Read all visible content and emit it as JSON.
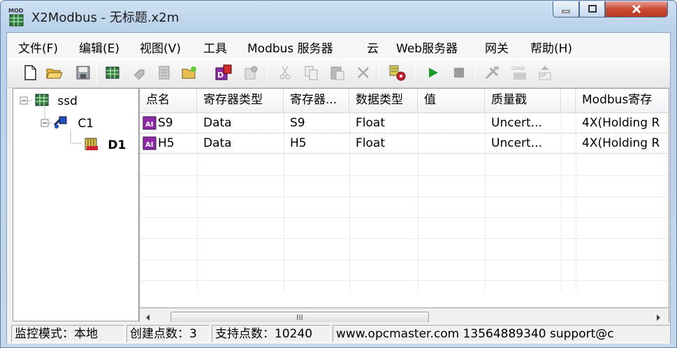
{
  "window": {
    "title": "X2Modbus - 无标题.x2m",
    "icon": "x2modbus-app-icon"
  },
  "menu": [
    "文件(F)",
    "编辑(E)",
    "视图(V)",
    "工具",
    "Modbus 服务器",
    "云",
    "Web服务器",
    "网关",
    "帮助(H)"
  ],
  "toolbar": [
    "new-file-icon",
    "open-folder-icon",
    "save-icon",
    "add-device-icon",
    "add-group-icon",
    "properties-icon",
    "add-point-icon",
    "add-data-icon",
    "settings-icon",
    "cut-icon",
    "copy-icon",
    "paste-icon",
    "delete-icon",
    "monitor-icon",
    "run-icon",
    "stop-icon",
    "tools-icon",
    "load-icon",
    "upload-icon"
  ],
  "tree": {
    "root": "ssd",
    "channel": "C1",
    "device": "D1"
  },
  "list": {
    "columns": [
      "点名",
      "寄存器类型",
      "寄存器...",
      "数据类型",
      "值",
      "质量戳",
      "",
      "Modbus寄存"
    ],
    "rows": [
      {
        "name": "S9",
        "reg_type": "Data",
        "register": "S9",
        "data_type": "Float",
        "value": "",
        "quality": "Uncert...",
        "extra": "",
        "modbus": "4X(Holding R"
      },
      {
        "name": "H5",
        "reg_type": "Data",
        "register": "H5",
        "data_type": "Float",
        "value": "",
        "quality": "Uncert...",
        "extra": "",
        "modbus": "4X(Holding R"
      }
    ]
  },
  "scroll": {
    "thumb_grip": "III"
  },
  "status": {
    "mode": "监控模式：本地",
    "created": "创建点数：3",
    "supported": "支持点数：10240",
    "info": "www.opcmaster.com 13564889340 support@c"
  },
  "colors": {
    "title_bg": "#c4d8ee",
    "close_btn": "#c94a32",
    "run": "#1a9a2a"
  }
}
